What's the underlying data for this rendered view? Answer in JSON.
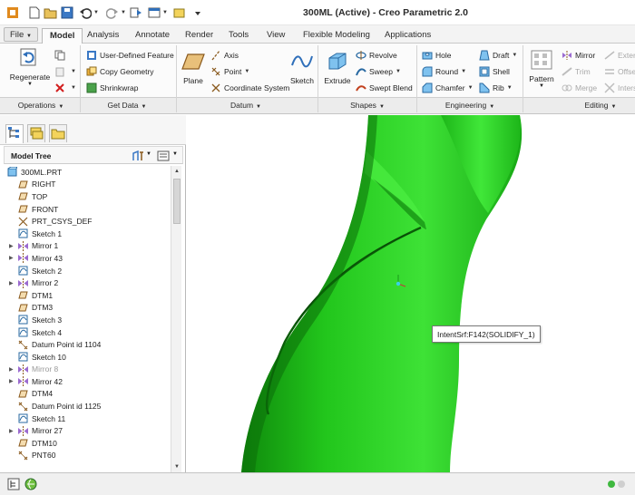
{
  "window": {
    "title": "300ML (Active) - Creo Parametric 2.0"
  },
  "quick_access": [
    "new-icon",
    "open-icon",
    "save-icon",
    "undo-icon",
    "redo-icon",
    "regenerate-icon",
    "windows-icon",
    "close-icon",
    "customize-icon"
  ],
  "tabs": [
    "File",
    "Model",
    "Analysis",
    "Annotate",
    "Render",
    "Tools",
    "View",
    "Flexible Modeling",
    "Applications"
  ],
  "active_tab": "Model",
  "ribbon": {
    "operations": {
      "regenerate": "Regenerate"
    },
    "get_data": {
      "user_defined": "User-Defined Feature",
      "copy_geometry": "Copy Geometry",
      "shrinkwrap": "Shrinkwrap"
    },
    "datum": {
      "plane": "Plane",
      "axis": "Axis",
      "point": "Point",
      "coord_sys": "Coordinate System",
      "sketch": "Sketch"
    },
    "shapes": {
      "extrude": "Extrude",
      "revolve": "Revolve",
      "sweep": "Sweep",
      "swept_blend": "Swept Blend"
    },
    "engineering": {
      "hole": "Hole",
      "round": "Round",
      "chamfer": "Chamfer",
      "draft": "Draft",
      "shell": "Shell",
      "rib": "Rib"
    },
    "editing": {
      "pattern": "Pattern",
      "mirror": "Mirror",
      "trim": "Trim",
      "merge": "Merge",
      "extend": "Extend",
      "offset": "Offset",
      "intersect": "Intersect"
    }
  },
  "groups": [
    "Operations",
    "Get Data",
    "Datum",
    "Shapes",
    "Engineering",
    "Editing"
  ],
  "model_tree": {
    "header": "Model Tree",
    "items": [
      {
        "label": "300ML.PRT",
        "icon": "part-icon",
        "expand": false,
        "root": true
      },
      {
        "label": "RIGHT",
        "icon": "datum-plane-icon",
        "expand": false
      },
      {
        "label": "TOP",
        "icon": "datum-plane-icon",
        "expand": false
      },
      {
        "label": "FRONT",
        "icon": "datum-plane-icon",
        "expand": false
      },
      {
        "label": "PRT_CSYS_DEF",
        "icon": "csys-icon",
        "expand": false
      },
      {
        "label": "Sketch 1",
        "icon": "sketch-icon",
        "expand": false
      },
      {
        "label": "Mirror 1",
        "icon": "mirror-icon",
        "expand": true
      },
      {
        "label": "Mirror 43",
        "icon": "mirror-icon",
        "expand": true
      },
      {
        "label": "Sketch 2",
        "icon": "sketch-icon",
        "expand": false
      },
      {
        "label": "Mirror 2",
        "icon": "mirror-icon",
        "expand": true
      },
      {
        "label": "DTM1",
        "icon": "datum-plane-icon",
        "expand": false
      },
      {
        "label": "DTM3",
        "icon": "datum-plane-icon",
        "expand": false
      },
      {
        "label": "Sketch 3",
        "icon": "sketch-icon",
        "expand": false
      },
      {
        "label": "Sketch 4",
        "icon": "sketch-icon",
        "expand": false
      },
      {
        "label": "Datum Point id 1104",
        "icon": "datum-point-icon",
        "expand": false
      },
      {
        "label": "Sketch 10",
        "icon": "sketch-icon",
        "expand": false
      },
      {
        "label": "Mirror 8",
        "icon": "mirror-icon",
        "expand": true,
        "dim": true
      },
      {
        "label": "Mirror 42",
        "icon": "mirror-icon",
        "expand": true
      },
      {
        "label": "DTM4",
        "icon": "datum-plane-icon",
        "expand": false
      },
      {
        "label": "Datum Point id 1125",
        "icon": "datum-point-icon",
        "expand": false
      },
      {
        "label": "Sketch 11",
        "icon": "sketch-icon",
        "expand": false
      },
      {
        "label": "Mirror 27",
        "icon": "mirror-icon",
        "expand": true
      },
      {
        "label": "DTM10",
        "icon": "datum-plane-icon",
        "expand": false
      },
      {
        "label": "PNT60",
        "icon": "datum-point-icon",
        "expand": false
      }
    ]
  },
  "tooltip": "IntentSrf:F142(SOLIDIFY_1)",
  "colors": {
    "model_green": "#22c61c",
    "accent_blue": "#2f6fba"
  }
}
